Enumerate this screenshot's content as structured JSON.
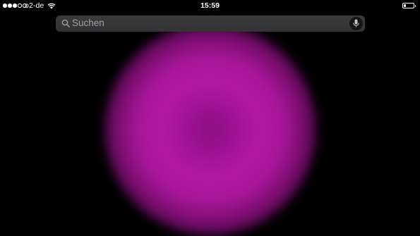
{
  "status_bar": {
    "signal_strength": 3,
    "signal_max": 5,
    "carrier": "o2-de",
    "wifi_icon": "wifi-icon",
    "time": "15:59",
    "battery_icon": "battery-icon",
    "battery_level": 0.2
  },
  "search": {
    "placeholder": "Suchen",
    "search_icon": "search-icon",
    "mic_icon": "microphone-icon"
  },
  "colors": {
    "background": "#000000",
    "glow": "#b01aa2"
  }
}
